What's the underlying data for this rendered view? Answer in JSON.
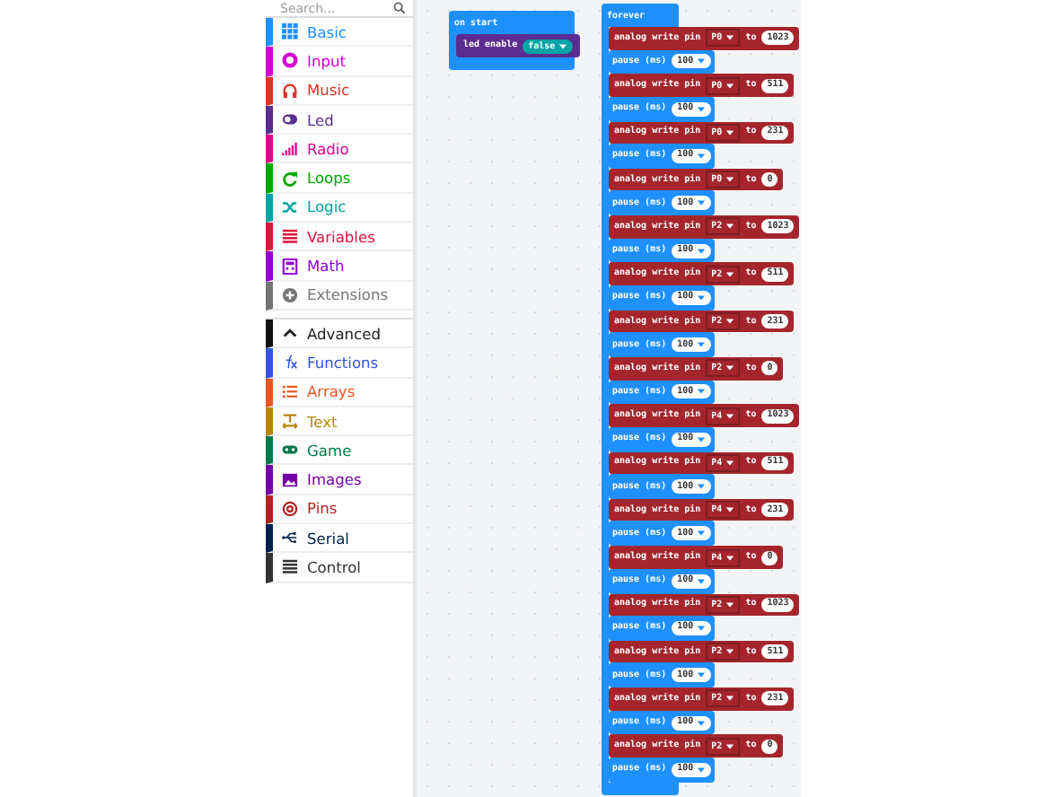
{
  "search": {
    "placeholder": "Search..."
  },
  "categories": [
    {
      "label": "Basic",
      "color": "#1e90ff"
    },
    {
      "label": "Input",
      "color": "#d400d4"
    },
    {
      "label": "Music",
      "color": "#e63022"
    },
    {
      "label": "Led",
      "color": "#5c2d91"
    },
    {
      "label": "Radio",
      "color": "#e3008c"
    },
    {
      "label": "Loops",
      "color": "#00aa00"
    },
    {
      "label": "Logic",
      "color": "#00a4a6"
    },
    {
      "label": "Variables",
      "color": "#dc143c"
    },
    {
      "label": "Math",
      "color": "#9400d3"
    },
    {
      "label": "Extensions",
      "color": "#757575"
    }
  ],
  "advanced": {
    "label": "Advanced",
    "expanded": true
  },
  "advanced_categories": [
    {
      "label": "Functions",
      "color": "#3455db"
    },
    {
      "label": "Arrays",
      "color": "#e65722"
    },
    {
      "label": "Text",
      "color": "#b8860b"
    },
    {
      "label": "Game",
      "color": "#007a4b"
    },
    {
      "label": "Images",
      "color": "#7600a8"
    },
    {
      "label": "Pins",
      "color": "#b22222"
    },
    {
      "label": "Serial",
      "color": "#002050"
    },
    {
      "label": "Control",
      "color": "#333333"
    }
  ],
  "on_start": {
    "title": "on start",
    "statements": [
      {
        "kind": "led_enable",
        "label": "led enable",
        "value": "false"
      }
    ]
  },
  "forever": {
    "title": "forever",
    "statements": [
      {
        "kind": "analog_write",
        "label": "analog write pin",
        "pin": "P0",
        "to": "to",
        "value": "1023"
      },
      {
        "kind": "pause",
        "label": "pause (ms)",
        "value": "100"
      },
      {
        "kind": "analog_write",
        "label": "analog write pin",
        "pin": "P0",
        "to": "to",
        "value": "511"
      },
      {
        "kind": "pause",
        "label": "pause (ms)",
        "value": "100"
      },
      {
        "kind": "analog_write",
        "label": "analog write pin",
        "pin": "P0",
        "to": "to",
        "value": "231"
      },
      {
        "kind": "pause",
        "label": "pause (ms)",
        "value": "100"
      },
      {
        "kind": "analog_write",
        "label": "analog write pin",
        "pin": "P0",
        "to": "to",
        "value": "0"
      },
      {
        "kind": "pause",
        "label": "pause (ms)",
        "value": "100"
      },
      {
        "kind": "analog_write",
        "label": "analog write pin",
        "pin": "P2",
        "to": "to",
        "value": "1023"
      },
      {
        "kind": "pause",
        "label": "pause (ms)",
        "value": "100"
      },
      {
        "kind": "analog_write",
        "label": "analog write pin",
        "pin": "P2",
        "to": "to",
        "value": "511"
      },
      {
        "kind": "pause",
        "label": "pause (ms)",
        "value": "100"
      },
      {
        "kind": "analog_write",
        "label": "analog write pin",
        "pin": "P2",
        "to": "to",
        "value": "231"
      },
      {
        "kind": "pause",
        "label": "pause (ms)",
        "value": "100"
      },
      {
        "kind": "analog_write",
        "label": "analog write pin",
        "pin": "P2",
        "to": "to",
        "value": "0"
      },
      {
        "kind": "pause",
        "label": "pause (ms)",
        "value": "100"
      },
      {
        "kind": "analog_write",
        "label": "analog write pin",
        "pin": "P4",
        "to": "to",
        "value": "1023"
      },
      {
        "kind": "pause",
        "label": "pause (ms)",
        "value": "100"
      },
      {
        "kind": "analog_write",
        "label": "analog write pin",
        "pin": "P4",
        "to": "to",
        "value": "511"
      },
      {
        "kind": "pause",
        "label": "pause (ms)",
        "value": "100"
      },
      {
        "kind": "analog_write",
        "label": "analog write pin",
        "pin": "P4",
        "to": "to",
        "value": "231"
      },
      {
        "kind": "pause",
        "label": "pause (ms)",
        "value": "100"
      },
      {
        "kind": "analog_write",
        "label": "analog write pin",
        "pin": "P4",
        "to": "to",
        "value": "0"
      },
      {
        "kind": "pause",
        "label": "pause (ms)",
        "value": "100"
      },
      {
        "kind": "analog_write",
        "label": "analog write pin",
        "pin": "P2",
        "to": "to",
        "value": "1023"
      },
      {
        "kind": "pause",
        "label": "pause (ms)",
        "value": "100"
      },
      {
        "kind": "analog_write",
        "label": "analog write pin",
        "pin": "P2",
        "to": "to",
        "value": "511"
      },
      {
        "kind": "pause",
        "label": "pause (ms)",
        "value": "100"
      },
      {
        "kind": "analog_write",
        "label": "analog write pin",
        "pin": "P2",
        "to": "to",
        "value": "231"
      },
      {
        "kind": "pause",
        "label": "pause (ms)",
        "value": "100"
      },
      {
        "kind": "analog_write",
        "label": "analog write pin",
        "pin": "P2",
        "to": "to",
        "value": "0"
      },
      {
        "kind": "pause",
        "label": "pause (ms)",
        "value": "100"
      }
    ]
  }
}
